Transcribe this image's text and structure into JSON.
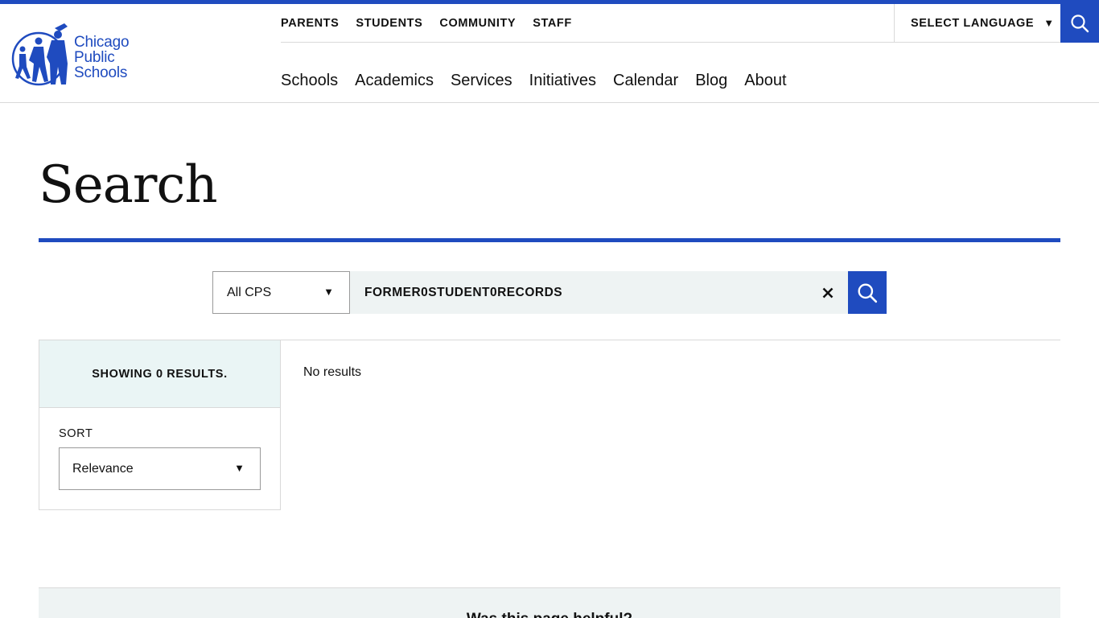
{
  "brand": {
    "logo_lines": [
      "Chicago",
      "Public",
      "Schools"
    ],
    "color": "#1f4bbf"
  },
  "utility_nav": [
    "PARENTS",
    "STUDENTS",
    "COMMUNITY",
    "STAFF"
  ],
  "language": {
    "label": "SELECT LANGUAGE",
    "caret": "▼"
  },
  "main_nav": [
    "Schools",
    "Academics",
    "Services",
    "Initiatives",
    "Calendar",
    "Blog",
    "About"
  ],
  "page": {
    "title": "Search"
  },
  "search": {
    "scope_value": "All CPS",
    "query": "FORMER0STUDENT0RECORDS",
    "clear_icon": "close-icon",
    "submit_icon": "search-icon"
  },
  "results": {
    "count_text": "SHOWING 0 RESULTS.",
    "sort_label": "SORT",
    "sort_value": "Relevance",
    "empty_text": "No results"
  },
  "feedback": {
    "title": "Was this page helpful?"
  }
}
